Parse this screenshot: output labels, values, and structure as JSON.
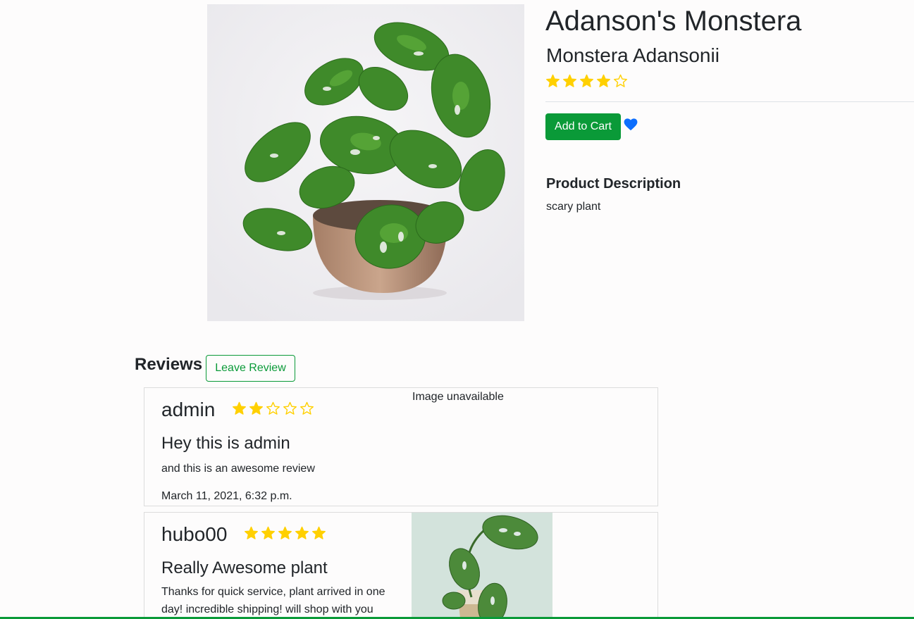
{
  "product": {
    "title": "Adanson's Monstera",
    "subtitle": "Monstera Adansonii",
    "rating": 4,
    "rating_max": 5,
    "add_to_cart_label": "Add to Cart",
    "description_heading": "Product Description",
    "description": "scary plant"
  },
  "reviews": {
    "heading": "Reviews",
    "leave_review_label": "Leave Review",
    "items": [
      {
        "author": "admin",
        "rating": 2,
        "title": "Hey this is admin",
        "body": "and this is an awesome review",
        "date": "March 11, 2021, 6:32 p.m.",
        "image_alt_text": "Image unavailable"
      },
      {
        "author": "hubo00",
        "rating": 5,
        "title": "Really Awesome plant",
        "body": "Thanks for quick service, plant arrived in one day! incredible shipping! will shop with you"
      }
    ]
  },
  "colors": {
    "accent_green": "#0a9a38",
    "star_gold": "#ffd000",
    "heart_blue": "#0d6efd"
  },
  "icons": {
    "star_filled": "star-filled-icon",
    "star_empty": "star-outline-icon",
    "wishlist": "heart-icon"
  }
}
